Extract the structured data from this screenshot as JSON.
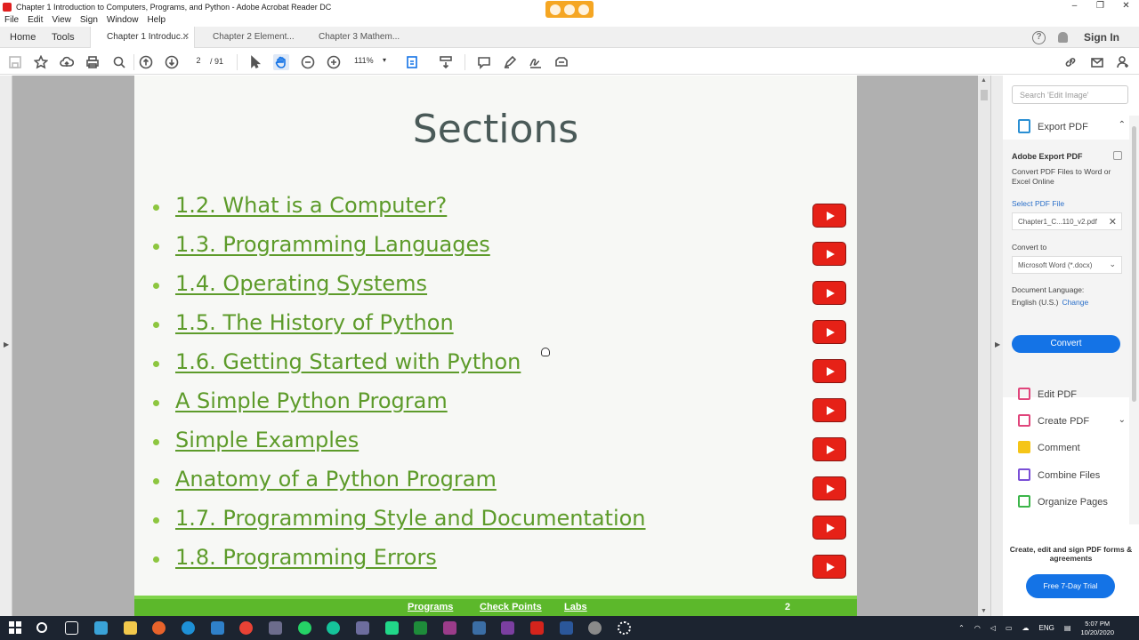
{
  "window": {
    "title": "Chapter 1 Introduction to Computers, Programs, and Python - Adobe Acrobat Reader DC",
    "controls": [
      "–",
      "❐",
      "✕"
    ]
  },
  "menu": [
    "File",
    "Edit",
    "View",
    "Sign",
    "Window",
    "Help"
  ],
  "tabs": {
    "home": "Home",
    "tools": "Tools",
    "docs": [
      {
        "label": "Chapter 1 Introduc...",
        "active": true
      },
      {
        "label": "Chapter 2 Element...",
        "active": false
      },
      {
        "label": "Chapter 3 Mathem...",
        "active": false
      }
    ],
    "close": "✕",
    "help": "?",
    "sign_in": "Sign In"
  },
  "toolbar": {
    "page_current": "2",
    "page_total": "/ 91",
    "zoom": "111%"
  },
  "slide": {
    "title": "Sections",
    "items": [
      "1.2. What is a Computer?",
      "1.3. Programming Languages",
      "1.4. Operating Systems",
      "1.5. The History of Python",
      "1.6. Getting Started with Python",
      "A Simple Python Program",
      "Simple Examples",
      "Anatomy of a Python Program",
      "1.7. Programming Style and Documentation",
      "1.8. Programming Errors"
    ],
    "footer_links": [
      "Programs",
      "Check Points",
      "Labs"
    ],
    "page_number": "2",
    "colors": {
      "link": "#5d9b2a",
      "bullet": "#8dc63f",
      "footer": "#5cb82b",
      "play": "#e62117"
    }
  },
  "right_pane": {
    "search_placeholder": "Search 'Edit Image'",
    "export_pdf": "Export PDF",
    "panel": {
      "heading": "Adobe Export PDF",
      "description": "Convert PDF Files to Word or Excel Online",
      "select_file": "Select PDF File",
      "file_name": "Chapter1_C...110_v2.pdf",
      "convert_to": "Convert to",
      "format": "Microsoft Word (*.docx)",
      "doc_language_label": "Document Language:",
      "doc_language": "English (U.S.)",
      "change": "Change",
      "convert_button": "Convert"
    },
    "tools": [
      {
        "label": "Edit PDF",
        "color": "#e0457b"
      },
      {
        "label": "Create PDF",
        "color": "#e0457b"
      },
      {
        "label": "Comment",
        "color": "#f5c518"
      },
      {
        "label": "Combine Files",
        "color": "#7a4fd6"
      },
      {
        "label": "Organize Pages",
        "color": "#3cb54a"
      }
    ],
    "promo": "Create, edit and sign PDF forms & agreements",
    "trial_button": "Free 7-Day Trial"
  },
  "taskbar": {
    "language": "ENG",
    "time": "5:07 PM",
    "date": "10/20/2020"
  }
}
